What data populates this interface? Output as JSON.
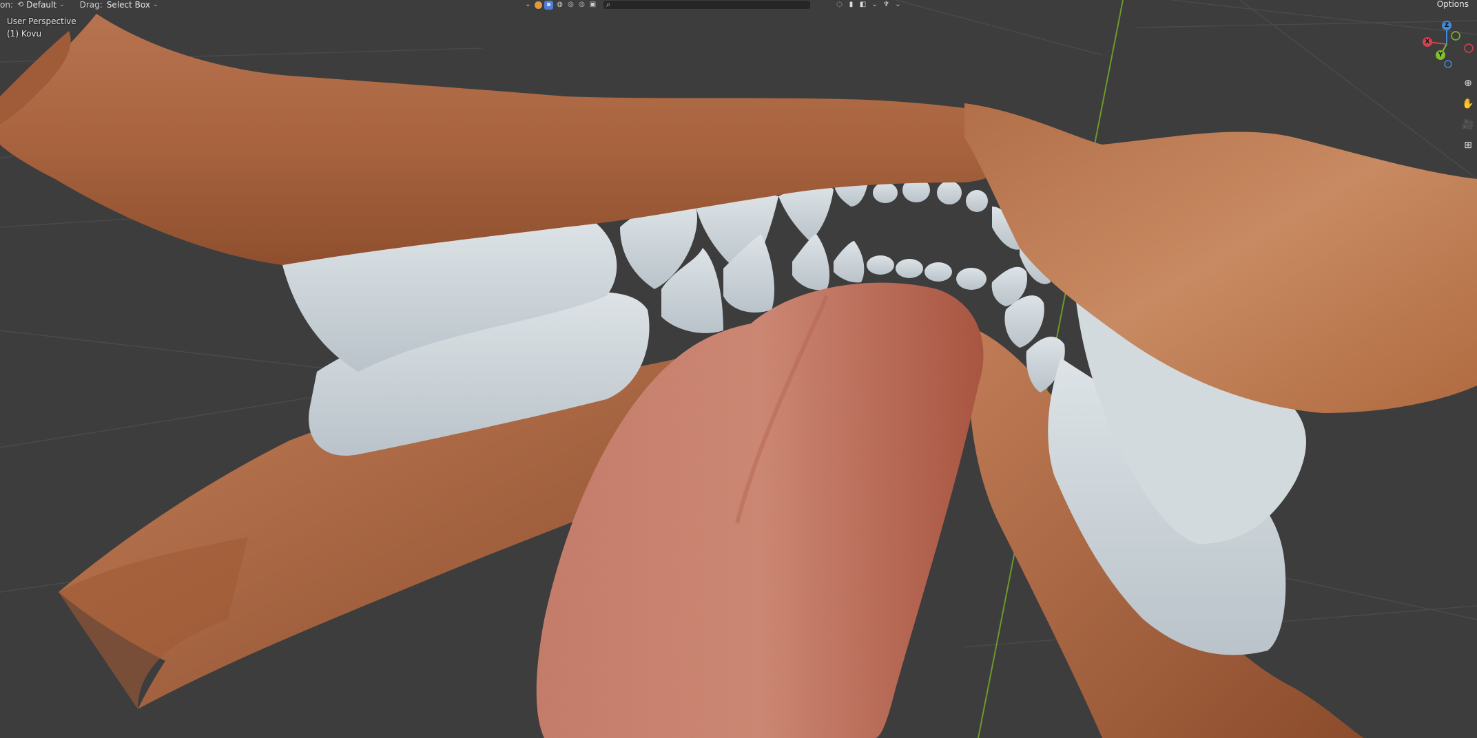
{
  "header": {
    "orientation_label_fragment": "on:",
    "orientation_value": "Default",
    "drag_label": "Drag:",
    "drag_value": "Select Box",
    "options_label": "Options"
  },
  "viewport": {
    "view_name": "User Perspective",
    "active_object": "(1) Kovu"
  },
  "gizmo": {
    "z_label": "Z",
    "x_label": "X",
    "y_label": "Y"
  },
  "colors": {
    "background": "#3c3c3c",
    "skin": "#c47b52",
    "teeth": "#c7d0d6",
    "tongue": "#c46a58",
    "axis_x": "#d4414f",
    "axis_y": "#7fbf2a",
    "axis_z": "#3c8ad9"
  },
  "icons": [
    "cursor-icon",
    "visibility-icon",
    "selectability-icon",
    "viewport-shading-icon",
    "search-icon",
    "overlay-icon",
    "gizmo-icon",
    "zoom-icon",
    "pan-hand-icon",
    "camera-icon",
    "orthographic-grid-icon"
  ]
}
